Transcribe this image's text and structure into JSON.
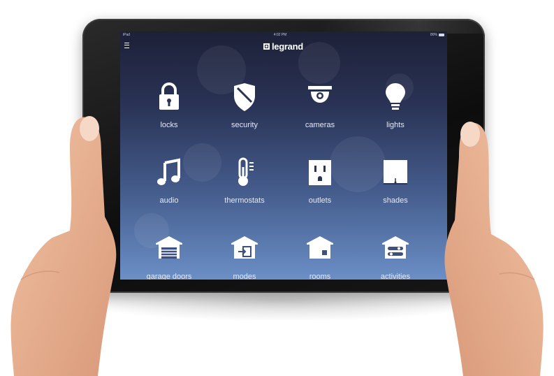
{
  "status_bar": {
    "carrier": "iPad",
    "time": "4:02 PM",
    "battery": "80%"
  },
  "header": {
    "brand": "legrand"
  },
  "tiles": [
    {
      "label": "locks",
      "icon": "lock-icon"
    },
    {
      "label": "security",
      "icon": "shield-icon"
    },
    {
      "label": "cameras",
      "icon": "camera-icon"
    },
    {
      "label": "lights",
      "icon": "lightbulb-icon"
    },
    {
      "label": "audio",
      "icon": "music-note-icon"
    },
    {
      "label": "thermostats",
      "icon": "thermometer-icon"
    },
    {
      "label": "outlets",
      "icon": "outlet-icon"
    },
    {
      "label": "shades",
      "icon": "shade-icon"
    },
    {
      "label": "garage doors",
      "icon": "garage-icon"
    },
    {
      "label": "modes",
      "icon": "modes-icon"
    },
    {
      "label": "rooms",
      "icon": "house-icon"
    },
    {
      "label": "activities",
      "icon": "activities-icon"
    }
  ],
  "colors": {
    "screen_top": "#1d2138",
    "screen_bottom": "#6b8fc6",
    "icon": "#ffffff"
  }
}
